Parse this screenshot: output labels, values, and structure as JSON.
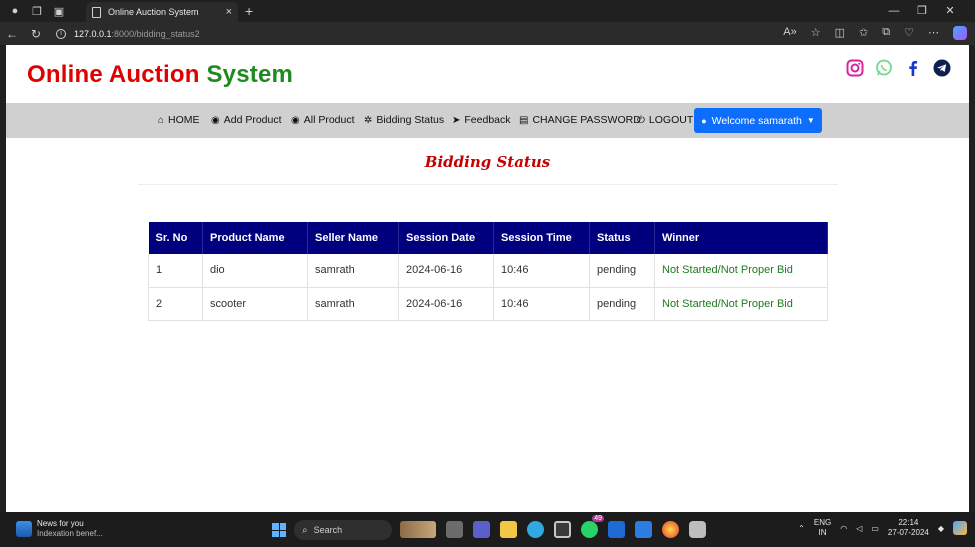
{
  "browser": {
    "tab_title": "Online Auction System",
    "url_host": "127.0.0.1",
    "url_path": ":8000/bidding_status2"
  },
  "site": {
    "brand_part1": "Online Auction",
    "brand_part2": "System",
    "social": [
      "instagram-icon",
      "whatsapp-icon",
      "facebook-icon",
      "telegram-icon"
    ]
  },
  "nav": {
    "items": [
      {
        "label": "HOME",
        "icon": "home-icon"
      },
      {
        "label": "Add Product",
        "icon": "eye-icon"
      },
      {
        "label": "All Product",
        "icon": "eye-icon"
      },
      {
        "label": "Bidding Status",
        "icon": "settings-icon"
      },
      {
        "label": "Feedback",
        "icon": "send-icon"
      },
      {
        "label": "CHANGE PASSWORD",
        "icon": "document-icon"
      },
      {
        "label": "LOGOUT",
        "icon": "power-icon"
      }
    ],
    "welcome": "Welcome samarath"
  },
  "page": {
    "heading": "Bidding Status"
  },
  "table": {
    "headers": [
      "Sr. No",
      "Product Name",
      "Seller Name",
      "Session Date",
      "Session Time",
      "Status",
      "Winner"
    ],
    "rows": [
      [
        "1",
        "dio",
        "samrath",
        "2024-06-16",
        "10:46",
        "pending",
        "Not Started/Not Proper Bid"
      ],
      [
        "2",
        "scooter",
        "samrath",
        "2024-06-16",
        "10:46",
        "pending",
        "Not Started/Not Proper Bid"
      ]
    ]
  },
  "taskbar": {
    "news_title": "News for you",
    "news_sub": "Indexation benef...",
    "search": "Search",
    "lang1": "ENG",
    "lang2": "IN",
    "time": "22:14",
    "date": "27-07-2024",
    "badge": "49"
  },
  "colors": {
    "brand_red": "#e00000",
    "brand_green": "#1f8a1f",
    "table_header": "#00007f",
    "welcome_button": "#0d6efd",
    "winner_text": "#1f7a1f"
  }
}
